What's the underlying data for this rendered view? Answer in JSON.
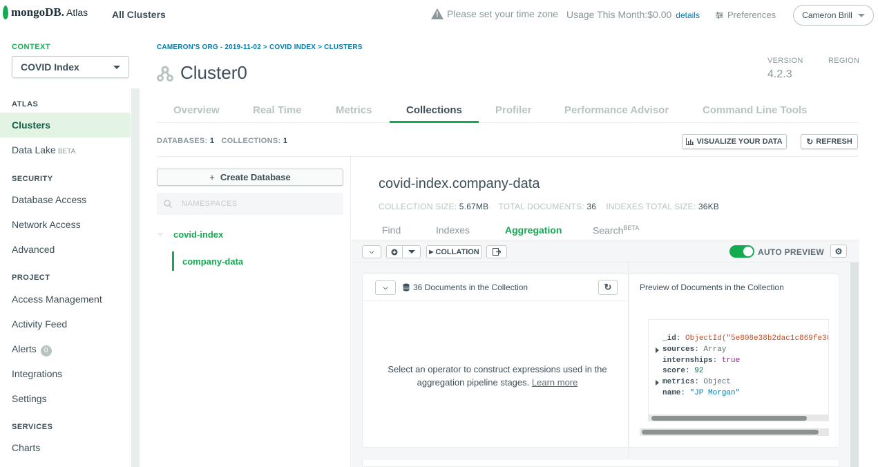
{
  "header": {
    "logo_text": "mongoDB.",
    "logo_product": "Atlas",
    "all_clusters": "All Clusters",
    "timezone_warning": "Please set your time zone",
    "usage_label": "Usage This Month:$0.00",
    "usage_details": "details",
    "preferences": "Preferences",
    "user_name": "Cameron Brill"
  },
  "sidebar": {
    "context_label": "CONTEXT",
    "context_value": "COVID Index",
    "atlas_label": "ATLAS",
    "clusters": "Clusters",
    "data_lake": "Data Lake",
    "data_lake_badge": "BETA",
    "security_label": "SECURITY",
    "database_access": "Database Access",
    "network_access": "Network Access",
    "advanced": "Advanced",
    "project_label": "PROJECT",
    "access_management": "Access Management",
    "activity_feed": "Activity Feed",
    "alerts": "Alerts",
    "alerts_count": "0",
    "integrations": "Integrations",
    "settings": "Settings",
    "services_label": "SERVICES",
    "charts": "Charts"
  },
  "main": {
    "breadcrumb": "CAMERON'S ORG - 2019-11-02 > COVID INDEX > CLUSTERS",
    "cluster_name": "Cluster0",
    "version_label": "VERSION",
    "version_value": "4.2.3",
    "region_label": "REGION",
    "tabs": [
      "Overview",
      "Real Time",
      "Metrics",
      "Collections",
      "Profiler",
      "Performance Advisor",
      "Command Line Tools"
    ],
    "active_tab": "Collections",
    "databases_label": "DATABASES:",
    "databases_count": "1",
    "collections_label": "COLLECTIONS:",
    "collections_count": "1",
    "visualize_button": "VISUALIZE YOUR DATA",
    "refresh_button": "REFRESH"
  },
  "namespaces": {
    "create_db": "Create Database",
    "search_placeholder": "NAMESPACES",
    "db_name": "covid-index",
    "collection_name": "company-data"
  },
  "collection": {
    "title": "covid-index.company-data",
    "size_label": "COLLECTION SIZE:",
    "size_value": "5.67MB",
    "docs_label": "TOTAL DOCUMENTS:",
    "docs_value": "36",
    "indexes_label": "INDEXES TOTAL SIZE:",
    "indexes_value": "36KB",
    "subtabs": {
      "find": "Find",
      "indexes": "Indexes",
      "aggregation": "Aggregation",
      "search": "Search",
      "search_badge": "BETA"
    }
  },
  "pipeline": {
    "collation": "COLLATION",
    "auto_preview": "AUTO PREVIEW",
    "docs_in_collection": "36 Documents in the Collection",
    "preview_title": "Preview of Documents in the Collection",
    "stage_message": "Select an operator to construct expressions used in the aggregation pipeline stages.",
    "learn_more": "Learn more",
    "document": {
      "id_key": "_id",
      "id_value": "ObjectId(\"5e808e38b2dac1c869fe30",
      "sources_key": "sources",
      "sources_value": "Array",
      "internships_key": "internships",
      "internships_value": "true",
      "score_key": "score",
      "score_value": "92",
      "metrics_key": "metrics",
      "metrics_value": "Object",
      "name_key": "name",
      "name_value": "\"JP Morgan\""
    }
  },
  "colors": {
    "brand_green": "#13aa52",
    "link_blue": "#007cad",
    "text": "#3d4f58"
  }
}
